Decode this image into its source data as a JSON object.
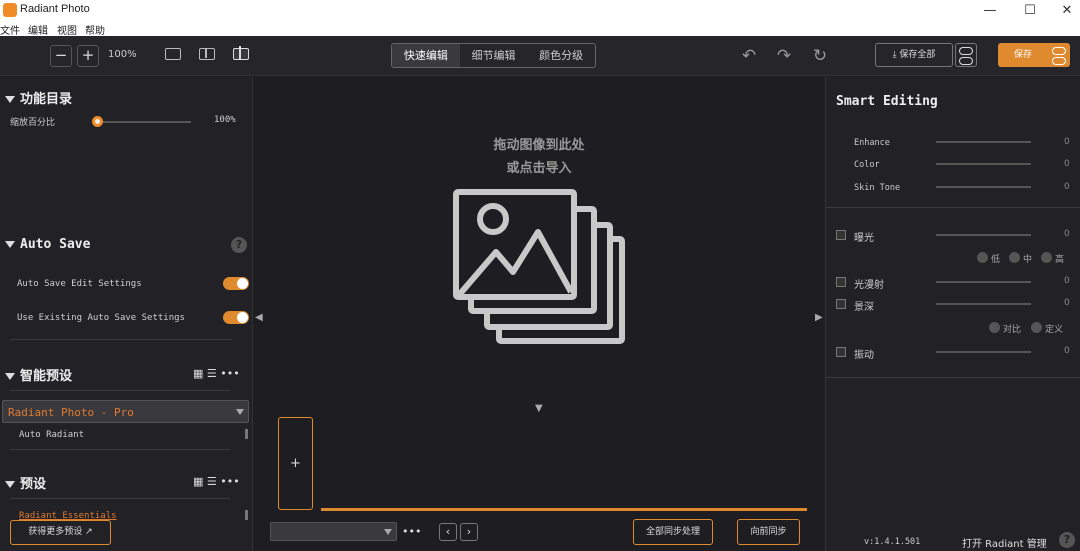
{
  "window": {
    "title": "Radiant Photo",
    "min": "—",
    "max": "☐",
    "close": "✕"
  },
  "menu": [
    "文件",
    "编辑",
    "视图",
    "帮助"
  ],
  "toolbar": {
    "zoom_out": "−",
    "zoom_in": "+",
    "zoom_level": "100%",
    "tabs": [
      {
        "label": "快速编辑",
        "active": true
      },
      {
        "label": "细节编辑",
        "active": false
      },
      {
        "label": "颜色分级",
        "active": false
      }
    ],
    "undo": "↶",
    "redo": "↷",
    "reset": "↻",
    "save_all": "⤓ 保存全部",
    "save": "保存"
  },
  "left": {
    "catalog": {
      "title": "功能目录",
      "zoom_label": "缩放百分比",
      "zoom_value": "100%",
      "zoom_fraction": 0
    },
    "autosave": {
      "title": "Auto Save",
      "help": "?",
      "items": [
        {
          "label": "Auto Save Edit Settings",
          "on": true
        },
        {
          "label": "Use Existing Auto Save Settings",
          "on": true
        }
      ]
    },
    "smart_presets": {
      "title": "智能预设",
      "icons": "▦ ☰ •••",
      "selected": "Radiant Photo - Pro",
      "sub_item": "Auto Radiant"
    },
    "presets": {
      "title": "预设",
      "icons": "▦ ☰ •••",
      "item": "Radiant Essentials"
    },
    "get_more": "获得更多预设 ↗"
  },
  "center": {
    "drop_line1": "拖动图像到此处",
    "drop_line2": "或点击导入",
    "collapse": "▼",
    "left_arrow": "◀",
    "right_arrow": "▶",
    "add": "+",
    "more": "•••",
    "prev": "‹",
    "next": "›",
    "batch": "全部同步处理",
    "sync": "向前同步"
  },
  "right": {
    "title": "Smart Editing",
    "sliders": [
      {
        "label": "Enhance",
        "value": "0"
      },
      {
        "label": "Color",
        "value": "0"
      },
      {
        "label": "Skin Tone",
        "value": "0"
      }
    ],
    "checks": [
      {
        "label": "曝光",
        "value": "0"
      },
      {
        "label": "光漫射",
        "value": "0"
      },
      {
        "label": "景深",
        "value": "0"
      },
      {
        "label": "振动",
        "value": "0"
      }
    ],
    "exposure_opts": [
      "低",
      "中",
      "高"
    ],
    "depth_opts": [
      "对比",
      "定义"
    ],
    "version": "v:1.4.1.501",
    "manage": "打开 Radiant 管理",
    "help": "?"
  },
  "colors": {
    "accent": "#e08a30",
    "panel": "#222226",
    "canvas": "#1e1e22"
  }
}
